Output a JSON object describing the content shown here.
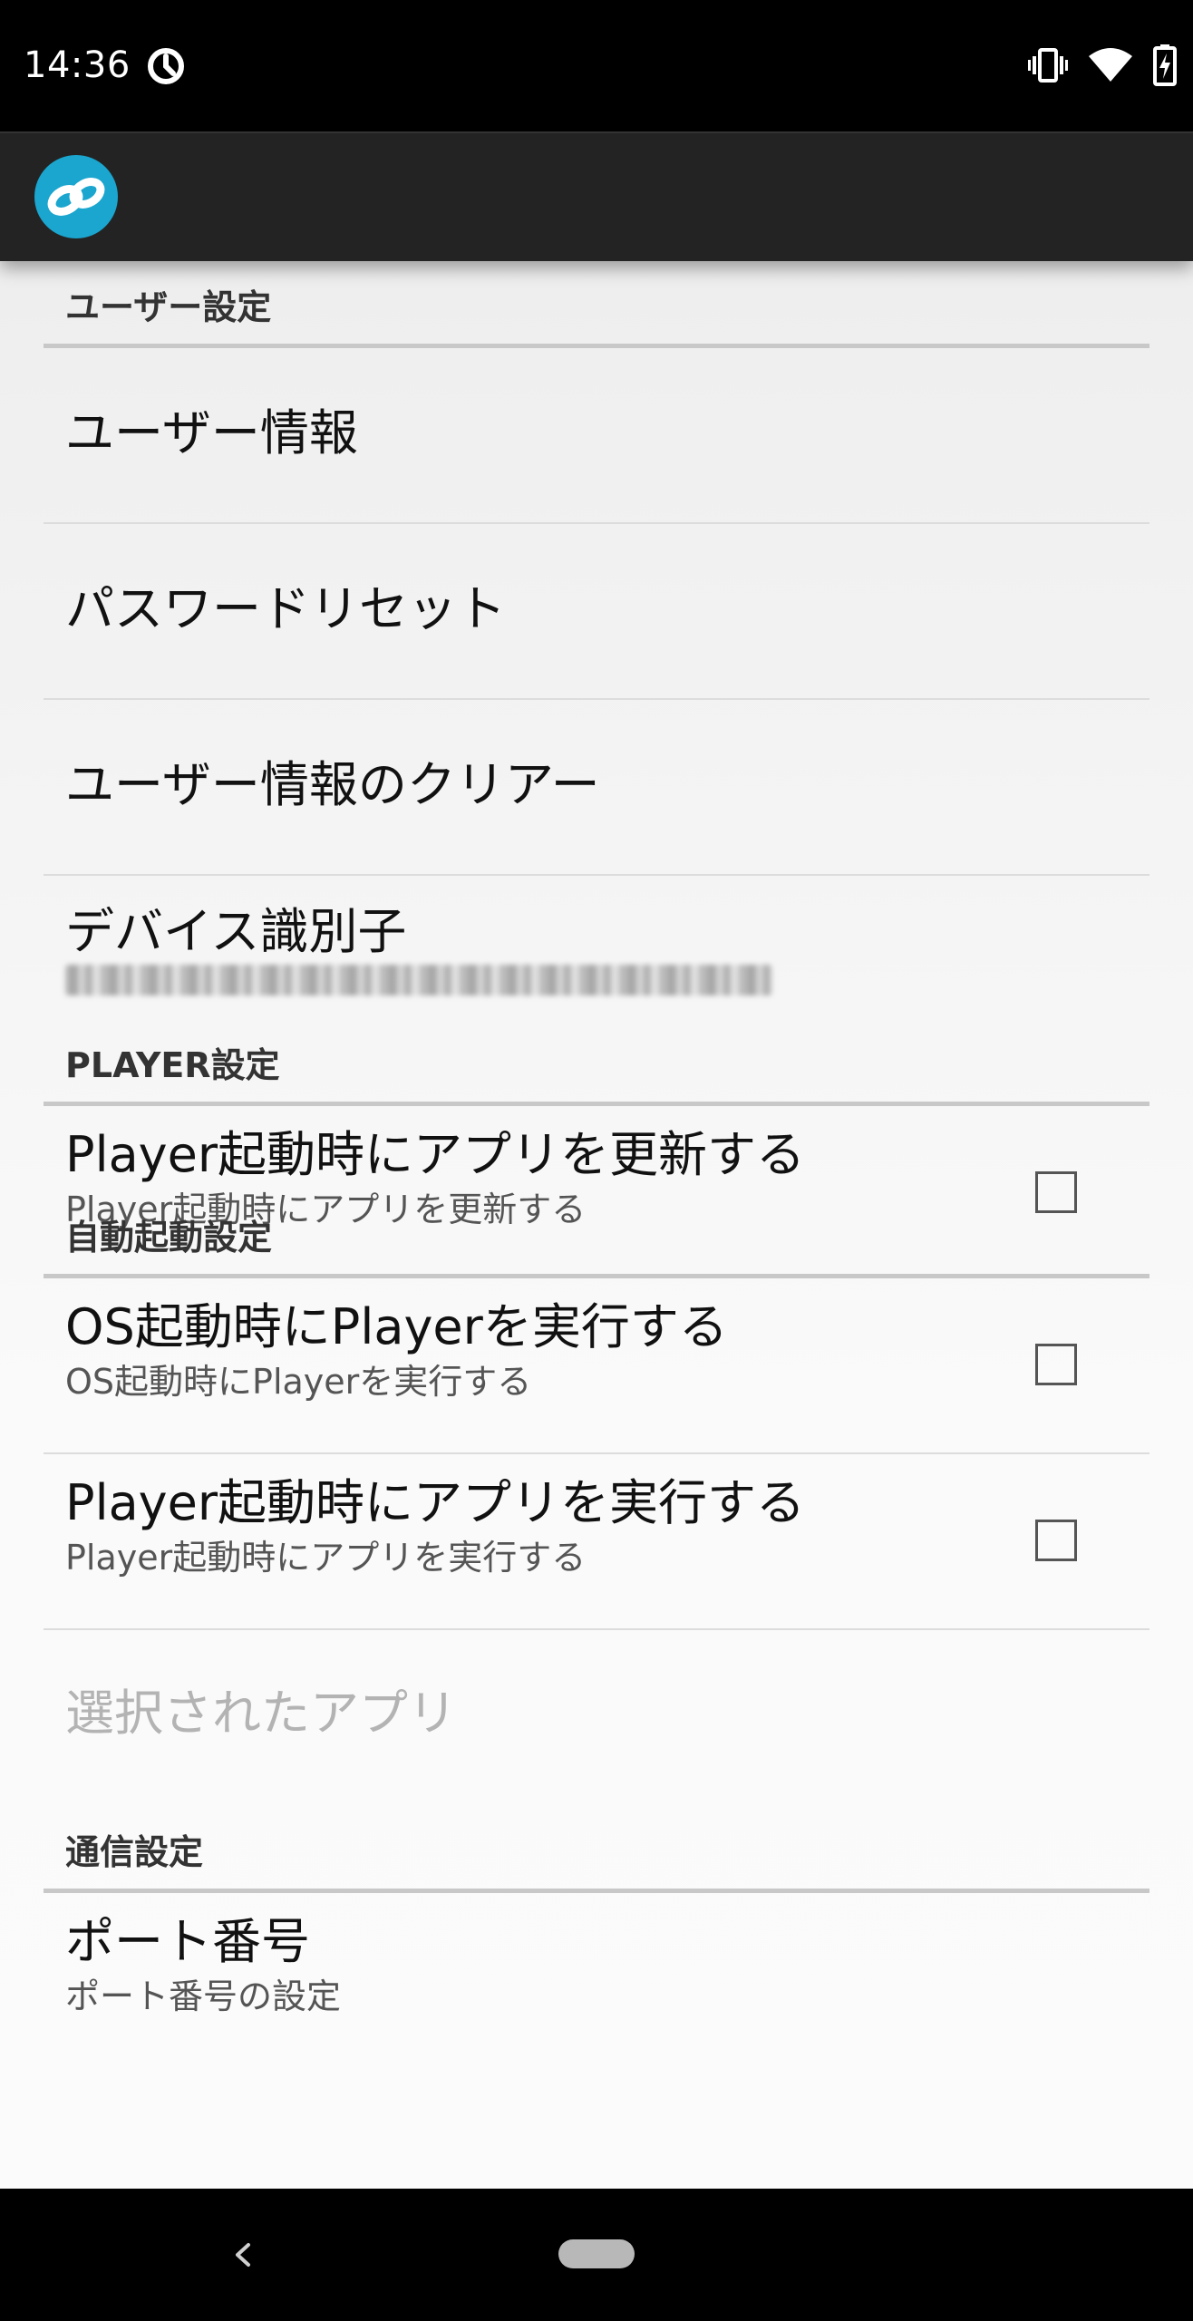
{
  "status_bar": {
    "time": "14:36",
    "icons": [
      "sync-icon",
      "vibrate-icon",
      "wifi-icon",
      "battery-charging-icon"
    ]
  },
  "app_bar": {
    "logo": "infinity-link-logo",
    "logo_color": "#1aa6cf"
  },
  "sections": {
    "user": {
      "header": "ユーザー設定",
      "user_info": "ユーザー情報",
      "password_reset": "パスワードリセット",
      "clear_user_info": "ユーザー情報のクリアー",
      "device_id_title": "デバイス識別子"
    },
    "player": {
      "header": "PLAYER設定",
      "update_app_title": "Player起動時にアプリを更新する",
      "update_app_summary": "Player起動時にアプリを更新する",
      "update_app_checked": false
    },
    "autostart": {
      "header": "自動起動設定",
      "run_on_boot_title": "OS起動時にPlayerを実行する",
      "run_on_boot_summary": "OS起動時にPlayerを実行する",
      "run_on_boot_checked": false,
      "run_app_title": "Player起動時にアプリを実行する",
      "run_app_summary": "Player起動時にアプリを実行する",
      "run_app_checked": false,
      "selected_app_title": "選択されたアプリ"
    },
    "network": {
      "header": "通信設定",
      "port_title": "ポート番号",
      "port_summary": "ポート番号の設定"
    }
  },
  "nav_bar": {
    "icons": [
      "back-icon",
      "home-pill-icon"
    ]
  }
}
